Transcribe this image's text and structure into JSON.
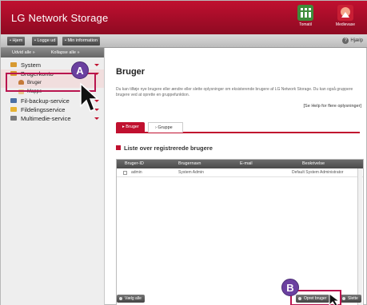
{
  "app": {
    "title": "LG Network Storage",
    "top_icons": [
      {
        "label": "Tomatil",
        "icon": "network-icon",
        "color": "#3e8c3a"
      },
      {
        "label": "Medievase",
        "icon": "media-icon",
        "color": "#e88a6a"
      }
    ]
  },
  "toolbar": {
    "buttons": [
      "• Hjem",
      "• Logge ud",
      "• Min information"
    ],
    "help_label": "Hjælp"
  },
  "sidebar": {
    "controls": [
      "Udvid alle »",
      "Kollapse alle »"
    ],
    "items": [
      {
        "label": "System",
        "icon": "system-icon",
        "color": "#d89a30",
        "level": 0,
        "expandable": true,
        "active": false
      },
      {
        "label": "Brugerkonto",
        "icon": "user-account-icon",
        "color": "#d89a30",
        "level": 0,
        "expandable": true,
        "active": true
      },
      {
        "label": "Bruger",
        "icon": "user-icon",
        "color": "#c57a3a",
        "level": 1,
        "expandable": false,
        "active": true
      },
      {
        "label": "Mappe",
        "icon": "folder-icon",
        "color": "#e6c68a",
        "level": 1,
        "expandable": false,
        "active": false
      },
      {
        "label": "Fil-backup-service",
        "icon": "backup-icon",
        "color": "#4a6fa5",
        "level": 0,
        "expandable": true,
        "active": false
      },
      {
        "label": "Fildelingsservice",
        "icon": "file-share-icon",
        "color": "#e7b332",
        "level": 0,
        "expandable": true,
        "active": false
      },
      {
        "label": "Multimedie-service",
        "icon": "multimedia-icon",
        "color": "#7a7a7a",
        "level": 0,
        "expandable": true,
        "active": false
      }
    ]
  },
  "main": {
    "page_title": "Bruger",
    "description": "Du kan tilføje nye brugere eller ændre eller slette oplysninger om eksisterende brugere af LG Network Storage. Du kan også gruppere brugere ved at oprette en gruppefunktion.",
    "help_link": "[Se Help for flere oplysninger]",
    "tabs": [
      "▸ Bruger",
      "› Gruppe"
    ],
    "section_title": "Liste over registrerede brugere",
    "table": {
      "columns": [
        "Bruger-ID",
        "Brugernavn",
        "E-mail",
        "Beskrivelse"
      ],
      "rows": [
        {
          "id": "admin",
          "name": "System Admin",
          "email": "",
          "description": "Default System Administrator"
        }
      ]
    },
    "buttons": {
      "select_all": "Vælg alle",
      "create_user": "Opret bruger",
      "delete": "Slette"
    }
  },
  "annotations": {
    "callout_a": "A",
    "callout_b": "B"
  },
  "colors": {
    "brand_red": "#c0102f",
    "callout": "#6b40a0",
    "highlight": "#b9154f"
  }
}
